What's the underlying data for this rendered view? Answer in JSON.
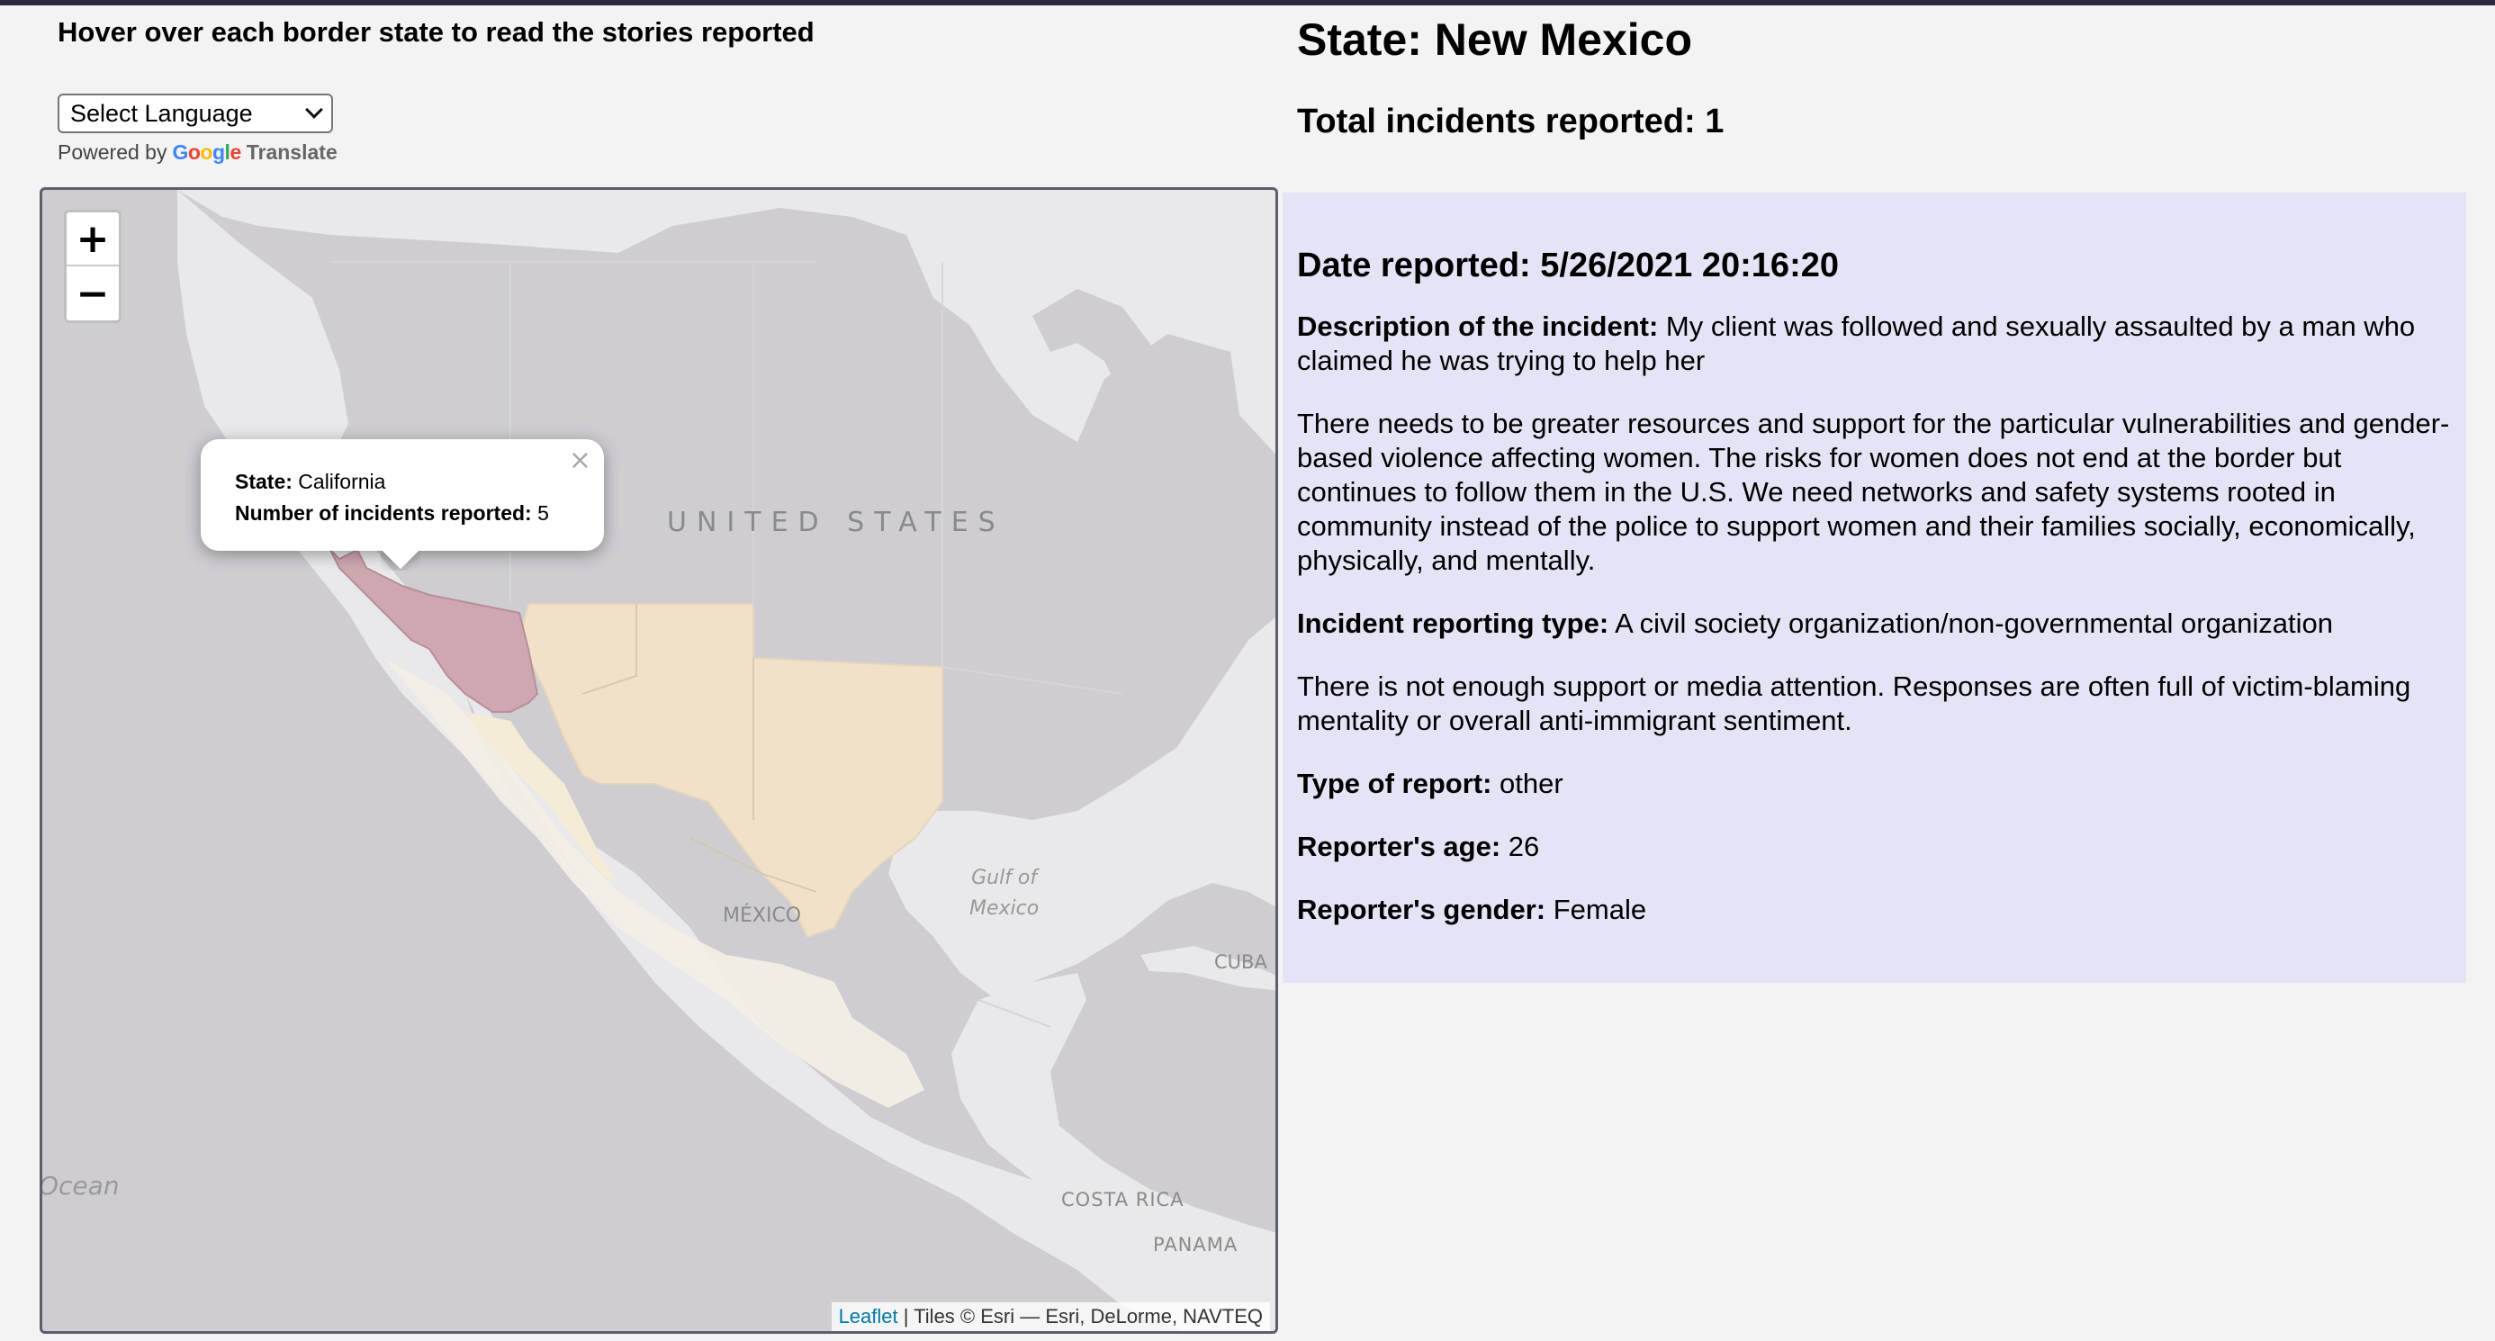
{
  "colors": {
    "page_background": "#f3f3f3",
    "panel_background": "#e4e4f6",
    "highlight_state": "#cfa7b0",
    "border_states": "#f1e1c8",
    "leaflet_link": "#0078a8"
  },
  "header": {
    "instructions": "Hover over each border state to read the stories reported"
  },
  "translate": {
    "select_label": "Select Language",
    "powered_by": "Powered by",
    "google_letters": [
      "G",
      "o",
      "o",
      "g",
      "l",
      "e"
    ],
    "translate_word": "Translate"
  },
  "map": {
    "zoom_in_label": "+",
    "zoom_out_label": "−",
    "labels": {
      "united_states": "UNITED STATES",
      "mexico": "MÉXICO",
      "gulf_line1": "Gulf of",
      "gulf_line2": "Mexico",
      "cuba": "CUBA",
      "costa_rica": "COSTA RICA",
      "panama": "PANAMA",
      "ocean": "Ocean"
    },
    "popup": {
      "state_label": "State:",
      "state_value": "California",
      "count_label": "Number of incidents reported:",
      "count_value": "5",
      "close_glyph": "×"
    },
    "attribution": {
      "leaflet": "Leaflet",
      "tiles": " | Tiles © Esri — Esri, DeLorme, NAVTEQ"
    }
  },
  "details": {
    "state_heading": "State: New Mexico",
    "total_heading": "Total incidents reported: 1",
    "date_heading": "Date reported: 5/26/2021 20:16:20",
    "description_label": "Description of the incident:",
    "description_value": " My client was followed and sexually assaulted by a man who claimed he was trying to help her",
    "paragraph_resources": "There needs to be greater resources and support for the particular vulnerabilities and gender-based violence affecting women. The risks for women does not end at the border but continues to follow them in the U.S. We need networks and safety systems rooted in community instead of the police to support women and their families socially, economically, physically, and mentally.",
    "reporting_type_label": "Incident reporting type:",
    "reporting_type_value": " A civil society organization/non-governmental organization",
    "paragraph_support": "There is not enough support or media attention. Responses are often full of victim-blaming mentality or overall anti-immigrant sentiment.",
    "report_type_label": "Type of report:",
    "report_type_value": " other",
    "age_label": "Reporter's age:",
    "age_value": " 26",
    "gender_label": "Reporter's gender:",
    "gender_value": " Female"
  }
}
